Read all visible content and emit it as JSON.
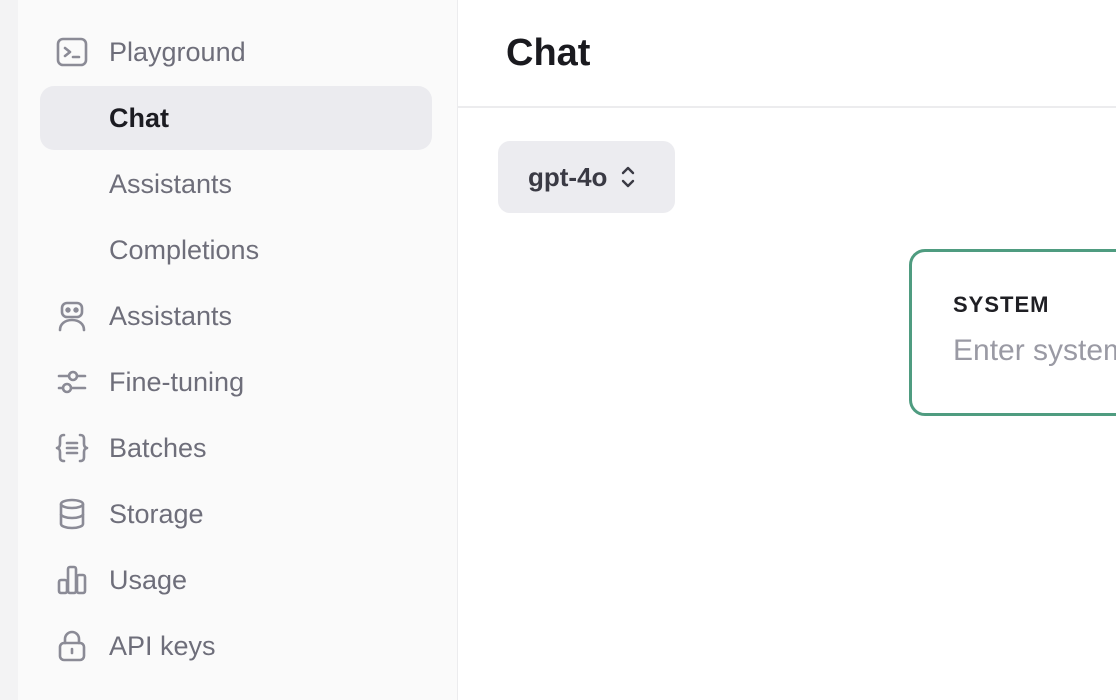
{
  "sidebar": {
    "items": [
      {
        "label": "Playground",
        "icon": "terminal-icon"
      },
      {
        "label": "Chat",
        "active": true
      },
      {
        "label": "Assistants"
      },
      {
        "label": "Completions"
      },
      {
        "label": "Assistants",
        "icon": "robot-icon"
      },
      {
        "label": "Fine-tuning",
        "icon": "sliders-icon"
      },
      {
        "label": "Batches",
        "icon": "braces-icon"
      },
      {
        "label": "Storage",
        "icon": "database-icon"
      },
      {
        "label": "Usage",
        "icon": "bar-chart-icon"
      },
      {
        "label": "API keys",
        "icon": "lock-icon"
      }
    ]
  },
  "header": {
    "title": "Chat"
  },
  "model_selector": {
    "value": "gpt-4o",
    "icon": "chevron-up-down-icon"
  },
  "system": {
    "label": "SYSTEM",
    "placeholder": "Enter system instructions"
  },
  "colors": {
    "accent_border": "#4f9c80",
    "active_bg": "#ebebef",
    "icon_gray": "#8b8b96"
  }
}
